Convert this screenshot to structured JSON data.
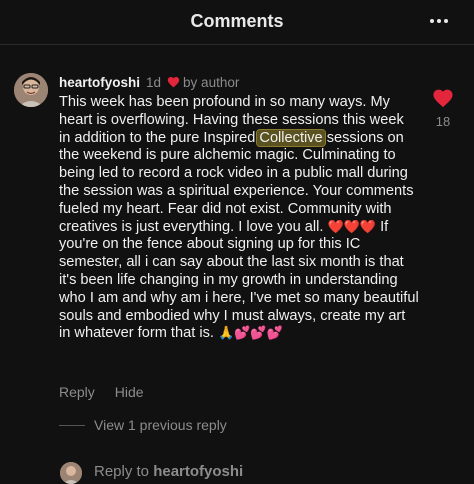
{
  "header": {
    "title": "Comments",
    "more_icon": "more-horizontal-icon"
  },
  "comment": {
    "author": "heartofyoshi",
    "time": "1d",
    "liked_by_author_label": "by author",
    "text_before_highlight": "This week has been profound in so many ways. My heart is overflowing. Having these sessions this week in addition to the pure Inspired ",
    "highlight": "Collective",
    "text_after_highlight": " sessions on the weekend is pure alchemic magic. Culminating to being led to record a rock video in a public mall during the session was a spiritual experience. Your comments fueled my heart. Fear did not exist. Community with creatives is just everything. I love you all. ",
    "emoji_hearts": "❤️❤️❤️",
    "text_second_part": " If you're on the fence about signing up for this IC semester, all i can say about the last six month is that it's been life changing in my growth in understanding who I am and why am i here, I've met so many beautiful souls and embodied why I must always, create my art in whatever form that is. ",
    "emoji_pray": "🙏",
    "emoji_sparkle_hearts": "💕💕💕",
    "like_count": "18",
    "like_color": "#e3263c",
    "actions": {
      "reply": "Reply",
      "hide": "Hide"
    }
  },
  "thread": {
    "view_previous": "View 1 previous reply"
  },
  "reply_bar": {
    "prefix": "Reply to ",
    "target": "heartofyoshi"
  }
}
